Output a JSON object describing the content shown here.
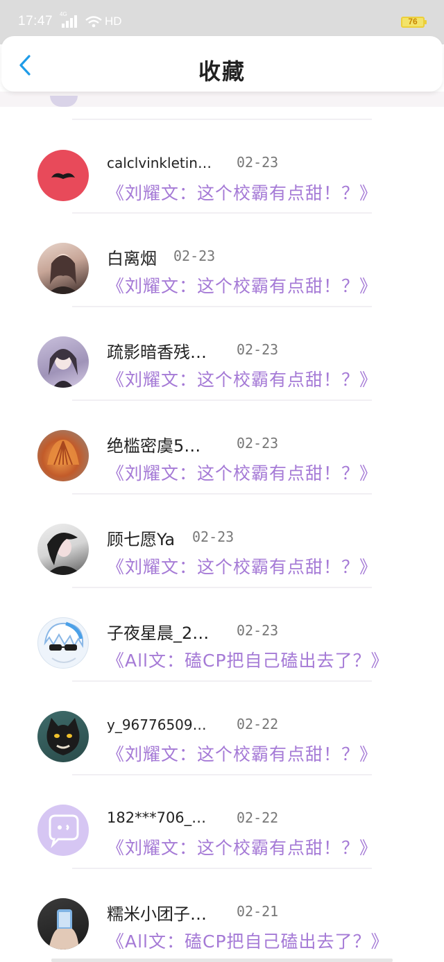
{
  "status_bar": {
    "time": "17:47",
    "network": "4G",
    "hd": "HD",
    "battery": "76"
  },
  "header": {
    "title": "收藏"
  },
  "items": [
    {
      "username": "calclvinkletin…",
      "date": "02-23",
      "title": "《刘耀文：这个校霸有点甜！？》",
      "avatar": "mustache-avatar"
    },
    {
      "username": "白离烟",
      "date": "02-23",
      "title": "《刘耀文：这个校霸有点甜！？》",
      "avatar": "photo-avatar"
    },
    {
      "username": "疏影暗香残…",
      "date": "02-23",
      "title": "《刘耀文：这个校霸有点甜！？》",
      "avatar": "anime-girl-avatar"
    },
    {
      "username": "绝槛密虞5…",
      "date": "02-23",
      "title": "《刘耀文：这个校霸有点甜！？》",
      "avatar": "shell-avatar"
    },
    {
      "username": "顾七愿Ya",
      "date": "02-23",
      "title": "《刘耀文：这个校霸有点甜！？》",
      "avatar": "photo-avatar"
    },
    {
      "username": "子夜星晨_2…",
      "date": "02-23",
      "title": "《All文：磕CP把自己磕出去了？》",
      "avatar": "anime-boy-avatar"
    },
    {
      "username": "y_96776509…",
      "date": "02-22",
      "title": "《刘耀文：这个校霸有点甜！？》",
      "avatar": "cat-avatar"
    },
    {
      "username": "182***706_…",
      "date": "02-22",
      "title": "《刘耀文：这个校霸有点甜！？》",
      "avatar": "default-chat-avatar"
    },
    {
      "username": "糯米小团子…",
      "date": "02-21",
      "title": "《All文：磕CP把自己磕出去了？》",
      "avatar": "photo-avatar"
    }
  ],
  "colors": {
    "accent": "#a57ad6",
    "date": "#777777",
    "back": "#1f9ce8"
  }
}
